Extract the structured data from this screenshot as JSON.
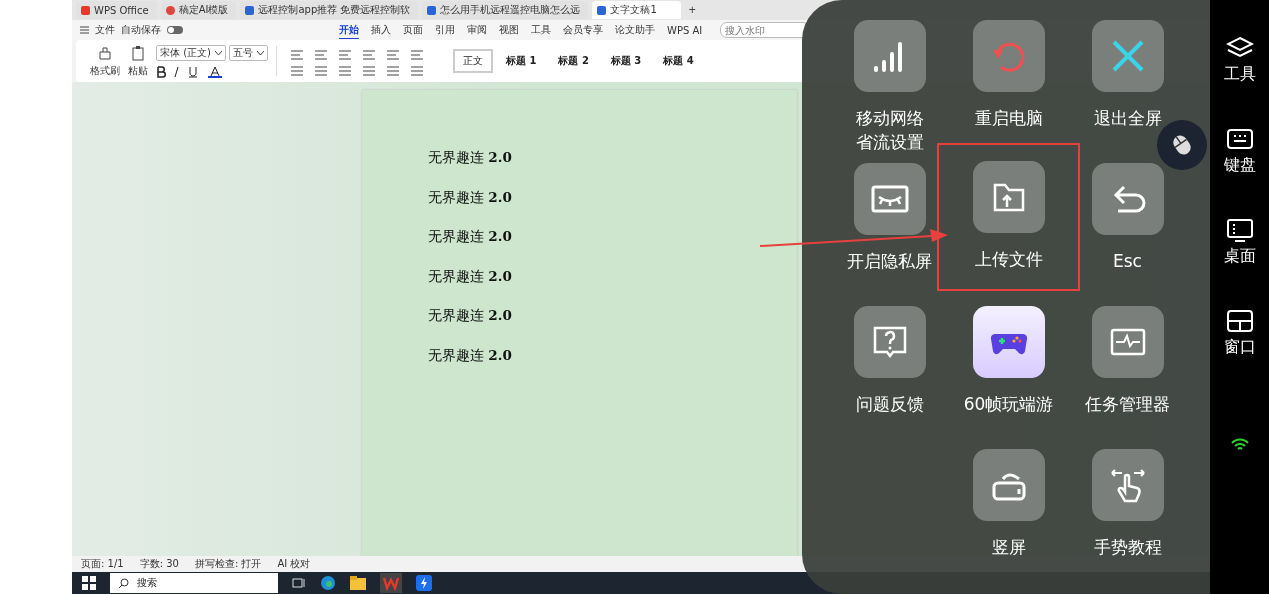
{
  "browser_tabs": [
    {
      "label": "WPS Office",
      "kind": "wps",
      "selected": false
    },
    {
      "label": "稿定AI模版",
      "kind": "ai",
      "selected": false
    },
    {
      "label": "远程控制app推荐 免费远程控制软",
      "kind": "doc",
      "selected": false
    },
    {
      "label": "怎么用手机远程遥控电脑怎么远",
      "kind": "doc",
      "selected": false
    },
    {
      "label": "文字文稿1",
      "kind": "doc",
      "selected": true
    }
  ],
  "new_tab": "+",
  "menu": {
    "file": "文件",
    "autosave": {
      "label": "自动保存",
      "on": false
    }
  },
  "ribbon_tabs": [
    {
      "label": "开始",
      "selected": true
    },
    {
      "label": "插入",
      "selected": false
    },
    {
      "label": "页面",
      "selected": false
    },
    {
      "label": "引用",
      "selected": false
    },
    {
      "label": "审阅",
      "selected": false
    },
    {
      "label": "视图",
      "selected": false
    },
    {
      "label": "工具",
      "selected": false
    },
    {
      "label": "会员专享",
      "selected": false
    },
    {
      "label": "论文助手",
      "selected": false
    },
    {
      "label": "WPS AI",
      "selected": false
    }
  ],
  "search": {
    "placeholder": "搜入水印"
  },
  "ribbon": {
    "format_painter": "格式刷",
    "paste": "粘贴",
    "font": "宋体 (正文)",
    "font_size": "五号",
    "styles": [
      {
        "label": "正文",
        "selected": true
      },
      {
        "label": "标题 1",
        "selected": false
      },
      {
        "label": "标题 2",
        "selected": false
      },
      {
        "label": "标题 3",
        "selected": false
      },
      {
        "label": "标题 4",
        "selected": false
      }
    ]
  },
  "document": {
    "lines": [
      "无界趣连 **2.0**",
      "无界趣连 **2.0**",
      "无界趣连 **2.0**",
      "无界趣连 **2.0**",
      "无界趣连 **2.0**",
      "无界趣连 **2.0**"
    ]
  },
  "status_bar": {
    "page": "页面: 1/1",
    "words": "字数: 30",
    "spell": "拼写检查: 打开",
    "ai_check": "AI 校对"
  },
  "taskbar": {
    "search": "搜索"
  },
  "overlay": {
    "tiles": [
      {
        "label": "移动网络省流设置",
        "kind": "signal",
        "highlighted": false
      },
      {
        "label": "重启电脑",
        "kind": "restart",
        "highlighted": false
      },
      {
        "label": "退出全屏",
        "kind": "close",
        "highlighted": false
      },
      {
        "label": "开启隐私屏",
        "kind": "privacy",
        "highlighted": false
      },
      {
        "label": "上传文件",
        "kind": "upload",
        "highlighted": true
      },
      {
        "label": "Esc",
        "kind": "back",
        "highlighted": false
      },
      {
        "label": "问题反馈",
        "kind": "feedback",
        "highlighted": false
      },
      {
        "label": "60帧玩端游",
        "kind": "gamepad",
        "highlighted": false
      },
      {
        "label": "任务管理器",
        "kind": "monitor",
        "highlighted": false
      },
      {
        "label": "竖屏",
        "kind": "rotate",
        "highlighted": false
      },
      {
        "label": "手势教程",
        "kind": "gesture",
        "highlighted": false
      }
    ]
  },
  "sidebar": [
    {
      "label": "工具",
      "kind": "layers"
    },
    {
      "label": "键盘",
      "kind": "keyboard"
    },
    {
      "label": "桌面",
      "kind": "desktop"
    },
    {
      "label": "窗口",
      "kind": "window"
    }
  ]
}
